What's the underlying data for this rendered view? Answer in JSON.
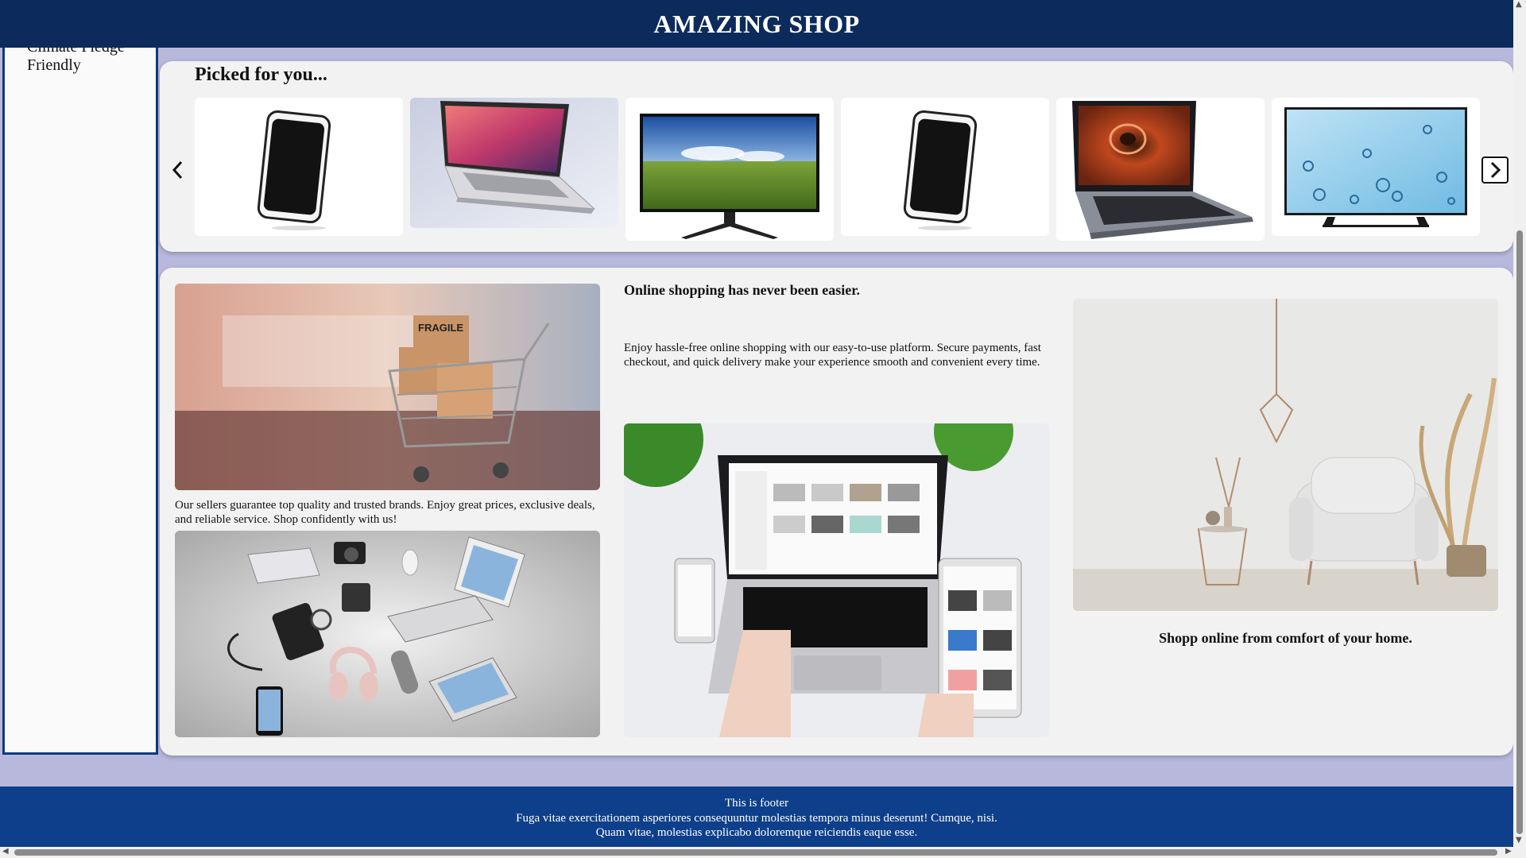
{
  "header": {
    "title": "AMAZING SHOP"
  },
  "sidebar": {
    "items": [
      "Climate Pledge",
      "Friendly"
    ]
  },
  "picked": {
    "heading": "Picked for you...",
    "products": [
      {
        "kind": "phone"
      },
      {
        "kind": "laptop-silver"
      },
      {
        "kind": "tv-landscape"
      },
      {
        "kind": "phone"
      },
      {
        "kind": "laptop-acer"
      },
      {
        "kind": "tv-water"
      }
    ]
  },
  "content": {
    "quality_text": "Our sellers guarantee top quality and trusted brands. Enjoy great prices, exclusive deals, and reliable service. Shop confidently with us!",
    "easy_heading": "Online shopping has never been easier.",
    "easy_text": "Enjoy hassle-free online shopping with our easy-to-use platform. Secure payments, fast checkout, and quick delivery make your experience smooth and convenient every time.",
    "comfort_caption": "Shopp online from comfort of your home."
  },
  "footer": {
    "line1": "This is footer",
    "line2": "Fuga vitae exercitationem asperiores consequuntur molestias tempora minus deserunt! Cumque, nisi.",
    "line3": "Quam vitae, molestias explicabo doloremque reiciendis eaque esse."
  },
  "colors": {
    "header_bg": "#0c2a5c",
    "footer_bg": "#0e3f8a",
    "page_bg": "#b8b8dc"
  },
  "icons": [
    "chevron-left-icon",
    "chevron-right-icon"
  ]
}
